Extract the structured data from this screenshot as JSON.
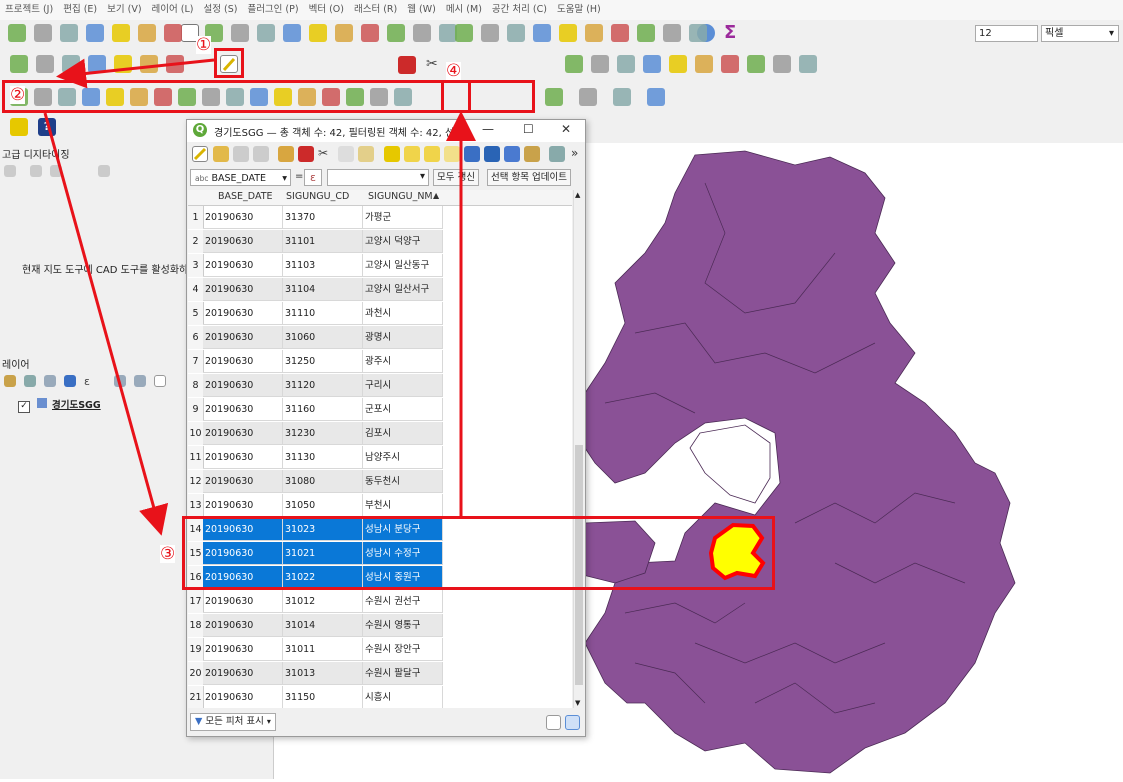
{
  "menubar": [
    "프로젝트 (J)",
    "편집 (E)",
    "보기 (V)",
    "레이어 (L)",
    "설정 (S)",
    "플러그인 (P)",
    "벡터 (O)",
    "래스터 (R)",
    "웹 (W)",
    "메시 (M)",
    "공간 처리 (C)",
    "도움말 (H)"
  ],
  "toolbar": {
    "font_size_value": "12",
    "unit_label": "픽셀"
  },
  "panels": {
    "advanced_digitizing_title": "고급 디지타이징",
    "cad_message": "현재 지도 도구에 CAD 도구를 활성화하",
    "layers_title": "레이어",
    "layer_name": "경기도SGG"
  },
  "attribute_window": {
    "title": "경기도SGG — 총 객체 수: 42, 필터링된 객체 수: 42, 선",
    "field_selector": "BASE_DATE",
    "field_selector_prefix": "abc",
    "operator": "=",
    "expression_icon": "ε",
    "update_all_label": "모두 갱신",
    "update_selected_label": "선택 항목 업데이트",
    "show_all_features_label": "모든 피처 표시",
    "columns": [
      "BASE_DATE",
      "SIGUNGU_CD",
      "SIGUNGU_NM"
    ],
    "rows": [
      {
        "n": "1",
        "d": "20190630",
        "c": "31370",
        "nm": "가평군",
        "selected": false
      },
      {
        "n": "2",
        "d": "20190630",
        "c": "31101",
        "nm": "고양시 덕양구",
        "selected": false
      },
      {
        "n": "3",
        "d": "20190630",
        "c": "31103",
        "nm": "고양시 일산동구",
        "selected": false
      },
      {
        "n": "4",
        "d": "20190630",
        "c": "31104",
        "nm": "고양시 일산서구",
        "selected": false
      },
      {
        "n": "5",
        "d": "20190630",
        "c": "31110",
        "nm": "과천시",
        "selected": false
      },
      {
        "n": "6",
        "d": "20190630",
        "c": "31060",
        "nm": "광명시",
        "selected": false
      },
      {
        "n": "7",
        "d": "20190630",
        "c": "31250",
        "nm": "광주시",
        "selected": false
      },
      {
        "n": "8",
        "d": "20190630",
        "c": "31120",
        "nm": "구리시",
        "selected": false
      },
      {
        "n": "9",
        "d": "20190630",
        "c": "31160",
        "nm": "군포시",
        "selected": false
      },
      {
        "n": "10",
        "d": "20190630",
        "c": "31230",
        "nm": "김포시",
        "selected": false
      },
      {
        "n": "11",
        "d": "20190630",
        "c": "31130",
        "nm": "남양주시",
        "selected": false
      },
      {
        "n": "12",
        "d": "20190630",
        "c": "31080",
        "nm": "동두천시",
        "selected": false
      },
      {
        "n": "13",
        "d": "20190630",
        "c": "31050",
        "nm": "부천시",
        "selected": false
      },
      {
        "n": "14",
        "d": "20190630",
        "c": "31023",
        "nm": "성남시 분당구",
        "selected": true
      },
      {
        "n": "15",
        "d": "20190630",
        "c": "31021",
        "nm": "성남시 수정구",
        "selected": true
      },
      {
        "n": "16",
        "d": "20190630",
        "c": "31022",
        "nm": "성남시 중원구",
        "selected": true
      },
      {
        "n": "17",
        "d": "20190630",
        "c": "31012",
        "nm": "수원시 권선구",
        "selected": false
      },
      {
        "n": "18",
        "d": "20190630",
        "c": "31014",
        "nm": "수원시 영통구",
        "selected": false
      },
      {
        "n": "19",
        "d": "20190630",
        "c": "31011",
        "nm": "수원시 장안구",
        "selected": false
      },
      {
        "n": "20",
        "d": "20190630",
        "c": "31013",
        "nm": "수원시 팔달구",
        "selected": false
      },
      {
        "n": "21",
        "d": "20190630",
        "c": "31150",
        "nm": "시흥시",
        "selected": false
      }
    ]
  },
  "annotations": {
    "labels": [
      "①",
      "②",
      "③",
      "④"
    ]
  },
  "colors": {
    "map_fill": "#8a5196",
    "selection_fill": "#ffff00",
    "selection_stroke": "#ff0000",
    "annotation": "#e8121a",
    "row_selected": "#0a78d7"
  }
}
